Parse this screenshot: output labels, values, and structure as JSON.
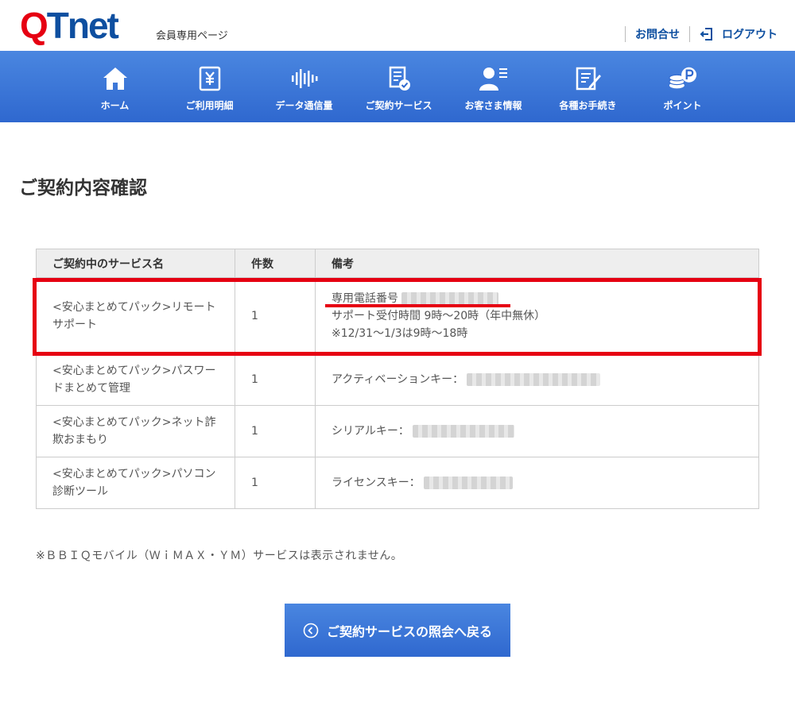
{
  "header": {
    "logo_q": "Q",
    "logo_rest": "Tnet",
    "member_label": "会員専用ページ",
    "contact_label": "お問合せ",
    "logout_label": "ログアウト"
  },
  "nav": {
    "items": [
      {
        "label": "ホーム",
        "icon": "home-icon"
      },
      {
        "label": "ご利用明細",
        "icon": "billing-icon"
      },
      {
        "label": "データ通信量",
        "icon": "data-usage-icon"
      },
      {
        "label": "ご契約サービス",
        "icon": "contract-icon"
      },
      {
        "label": "お客さま情報",
        "icon": "customer-info-icon"
      },
      {
        "label": "各種お手続き",
        "icon": "procedure-icon"
      },
      {
        "label": "ポイント",
        "icon": "points-icon"
      }
    ]
  },
  "page": {
    "title": "ご契約内容確認"
  },
  "table": {
    "headers": [
      "ご契約中のサービス名",
      "件数",
      "備考"
    ],
    "rows": [
      {
        "name": "<安心まとめてパック>リモートサポート",
        "count": "1",
        "note_line1": "専用電話番号",
        "note_line2": "サポート受付時間 9時～20時（年中無休）",
        "note_line3": "※12/31～1/3は9時～18時"
      },
      {
        "name": "<安心まとめてパック>パスワードまとめて管理",
        "count": "1",
        "note_line1": "アクティベーションキー："
      },
      {
        "name": "<安心まとめてパック>ネット詐欺おまもり",
        "count": "1",
        "note_line1": "シリアルキー："
      },
      {
        "name": "<安心まとめてパック>パソコン診断ツール",
        "count": "1",
        "note_line1": "ライセンスキー："
      }
    ]
  },
  "footnote": "※ＢＢＩＱモバイル（ＷｉＭＡＸ・ＹＭ）サービスは表示されません。",
  "back_button": {
    "label": "ご契約サービスの照会へ戻る",
    "icon": "chevron-left-circle-icon"
  },
  "colors": {
    "brand_blue": "#2f68cf",
    "brand_red": "#e60012",
    "logo_blue": "#0e4fa0"
  }
}
